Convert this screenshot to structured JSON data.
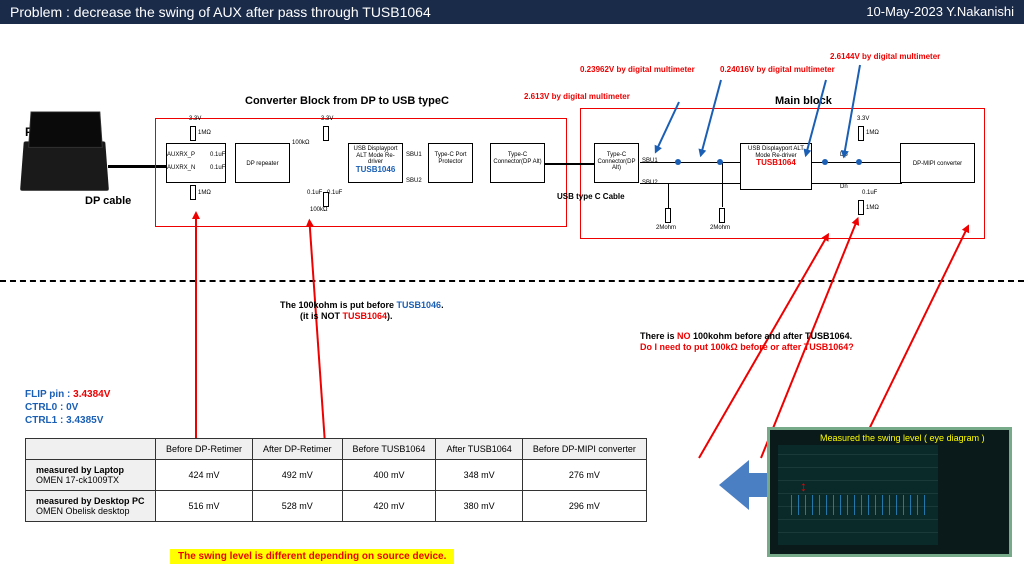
{
  "header": {
    "title": "Problem : decrease the swing of AUX after pass through TUSB1064",
    "meta": "10-May-2023 Y.Nakanishi"
  },
  "labels": {
    "pc": "PC",
    "dp_cable": "DP cable",
    "block1_title": "Converter Block from DP to USB typeC",
    "block2_title": "Main block",
    "usb_c_cable": "USB type C Cable",
    "v33_1": "3.3V",
    "v33_2": "3.3V",
    "v33_3": "3.3V",
    "r1m_1": "1MΩ",
    "r1m_2": "1MΩ",
    "r1m_3": "1MΩ",
    "r1m_4": "1MΩ",
    "r100k_1": "100kΩ",
    "r100k_2": "100kΩ",
    "c01_1": "0.1uF",
    "c01_2": "0.1uF",
    "c01_3": "0.1uF",
    "c01_4": "0.1uF",
    "c01_5": "0.1uF",
    "r2m_1": "2Mohm",
    "r2m_2": "2Mohm",
    "auxrx_p": "AUXRX_P",
    "auxrx_n": "AUXRX_N",
    "sbu1": "SBU1",
    "sbu2": "SBU2",
    "sbu1_2": "SBU1",
    "sbu2_2": "SBU2",
    "dp": "Dp",
    "dn": "Dn",
    "dp_repeater": "DP repeater",
    "tusb1046_desc": "USB Displayport ALT Mode Re-driver",
    "tusb1046": "TUSB1046",
    "port_protector": "Type-C Port Protector",
    "connector1": "Type-C Connector(DP Alt)",
    "connector2": "Type-C Connector(DP Alt)",
    "tusb1064_desc": "USB Displayport ALT Mode Re-driver",
    "tusb1064": "TUSB1064",
    "dp_mipi": "DP-MIPI converter"
  },
  "measurements": {
    "m1": "2.613V by digital multimeter",
    "m2": "0.23962V by digital multimeter",
    "m3": "0.24016V by digital multimeter",
    "m4": "2.6144V by digital multimeter"
  },
  "notes": {
    "note1a": "The 100kohm is put before ",
    "note1b": "TUSB1046",
    "note1c": ".",
    "note1d": "(it is NOT ",
    "note1e": "TUSB1064",
    "note1f": ").",
    "note2a": "There is ",
    "note2b": "NO",
    "note2c": " 100kohm before and after TUSB1064.",
    "note2d": "Do I need to put 100kΩ before or after TUSB1064?"
  },
  "pins": {
    "flip_label": "FLIP pin : ",
    "flip_val": "3.4384V",
    "ctrl0": "CTRL0 : 0V",
    "ctrl1": "CTRL1 : 3.4385V"
  },
  "table": {
    "headers": [
      "",
      "Before DP-Retimer",
      "After DP-Retimer",
      "Before TUSB1064",
      "After TUSB1064",
      "Before DP-MIPI converter"
    ],
    "rows": [
      {
        "label_main": "measured by Laptop",
        "label_sub": "OMEN 17-ck1009TX",
        "vals": [
          "424 mV",
          "492 mV",
          "400 mV",
          "348 mV",
          "276 mV"
        ]
      },
      {
        "label_main": "measured by Desktop PC",
        "label_sub": "OMEN Obelisk desktop",
        "vals": [
          "516 mV",
          "528 mV",
          "420 mV",
          "380 mV",
          "296 mV"
        ]
      }
    ]
  },
  "footer": "The swing level is different depending on source device.",
  "scope": {
    "title": "Measured the swing level ( eye diagram )"
  }
}
